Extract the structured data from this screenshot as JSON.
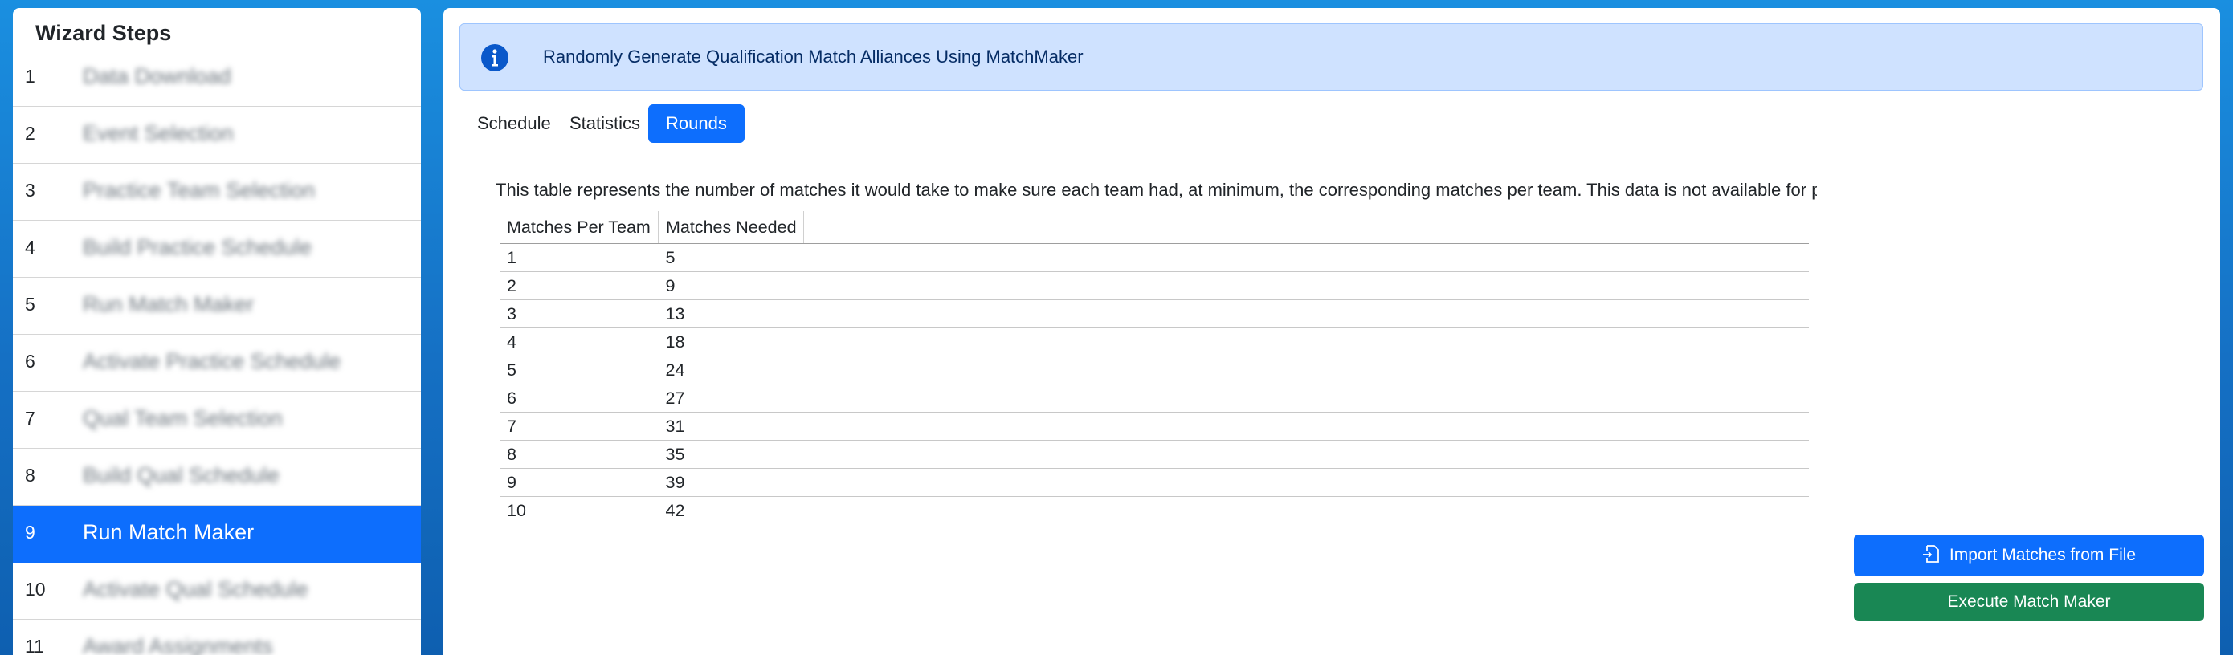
{
  "sidebar": {
    "title": "Wizard Steps",
    "steps": [
      {
        "num": "1",
        "label": "Data Download"
      },
      {
        "num": "2",
        "label": "Event Selection"
      },
      {
        "num": "3",
        "label": "Practice Team Selection"
      },
      {
        "num": "4",
        "label": "Build Practice Schedule"
      },
      {
        "num": "5",
        "label": "Run Match Maker"
      },
      {
        "num": "6",
        "label": "Activate Practice Schedule"
      },
      {
        "num": "7",
        "label": "Qual Team Selection"
      },
      {
        "num": "8",
        "label": "Build Qual Schedule"
      },
      {
        "num": "9",
        "label": "Run Match Maker"
      },
      {
        "num": "10",
        "label": "Activate Qual Schedule"
      },
      {
        "num": "11",
        "label": "Award Assignments"
      }
    ],
    "active_step": "9"
  },
  "alert": {
    "icon": "info-circle-icon",
    "text": "Randomly Generate Qualification Match Alliances Using MatchMaker"
  },
  "tabs": [
    {
      "label": "Schedule"
    },
    {
      "label": "Statistics"
    },
    {
      "label": "Rounds"
    }
  ],
  "active_tab": "Rounds",
  "description": "This table represents the number of matches it would take to make sure each team had, at minimum, the corresponding matches per team. This data is not available for pr",
  "table": {
    "headers": [
      "Matches Per Team",
      "Matches Needed"
    ],
    "rows": [
      [
        "1",
        "5"
      ],
      [
        "2",
        "9"
      ],
      [
        "3",
        "13"
      ],
      [
        "4",
        "18"
      ],
      [
        "5",
        "24"
      ],
      [
        "6",
        "27"
      ],
      [
        "7",
        "31"
      ],
      [
        "8",
        "35"
      ],
      [
        "9",
        "39"
      ],
      [
        "10",
        "42"
      ]
    ]
  },
  "buttons": {
    "import_label": "Import Matches from File",
    "import_icon": "file-import-icon",
    "execute_label": "Execute Match Maker"
  },
  "colors": {
    "primary": "#0d6efd",
    "success": "#198754",
    "alert_bg": "#cfe2ff",
    "alert_text": "#052c65",
    "page_bg": "#1a8fe0"
  }
}
